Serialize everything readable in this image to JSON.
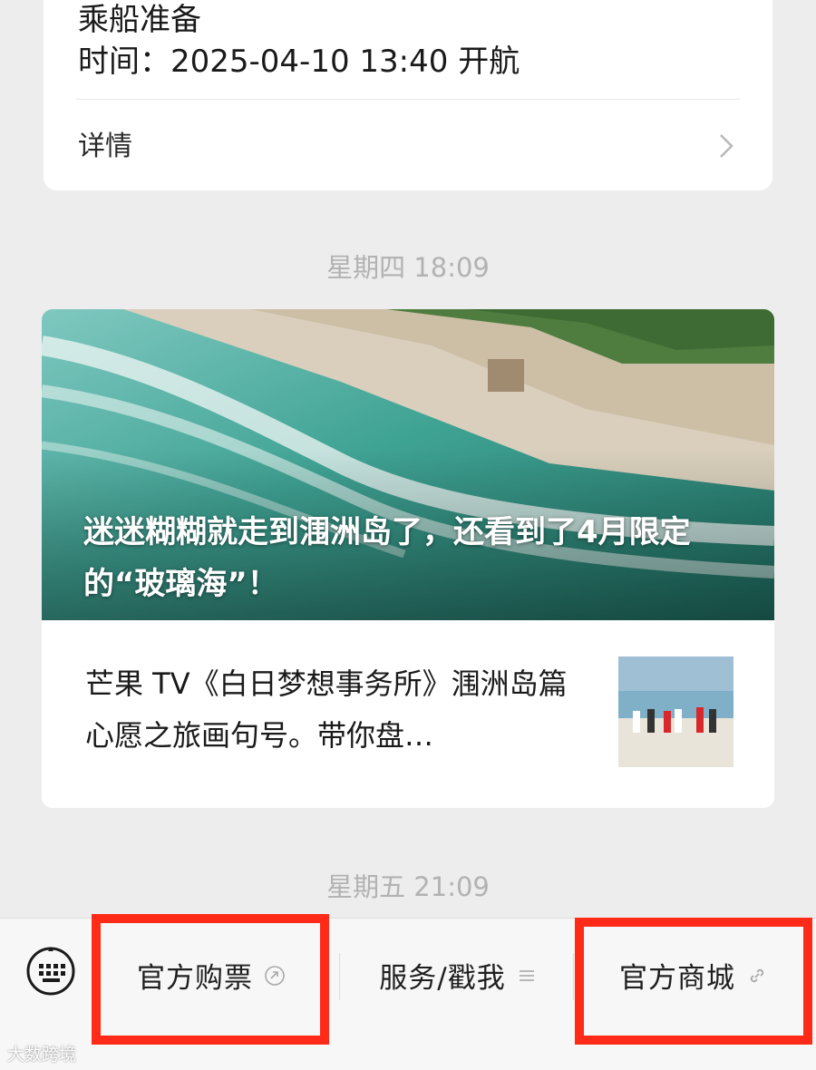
{
  "trip_card": {
    "title": "乘船准备",
    "time_line": "时间：2025-04-10 13:40 开航",
    "detail_label": "详情",
    "detail_chevron_icon": "chevron-right-icon"
  },
  "timestamps": [
    "星期四 18:09",
    "星期五 21:09"
  ],
  "article": {
    "hero_title": "迷迷糊糊就走到涠洲岛了，还看到了4月限定的“玻璃海”！",
    "sub_title": "芒果 TV《白日梦想事务所》涠洲岛篇心愿之旅画句号。带你盘…"
  },
  "menu": {
    "keyboard_icon": "keyboard-icon",
    "items": [
      {
        "label": "官方购票",
        "icon": "link-icon"
      },
      {
        "label": "服务/戳我",
        "icon": "menu-lines-icon"
      },
      {
        "label": "官方商城",
        "icon": "link-icon"
      }
    ],
    "highlight_color": "#ff2a17"
  },
  "watermark": "大数跨境"
}
